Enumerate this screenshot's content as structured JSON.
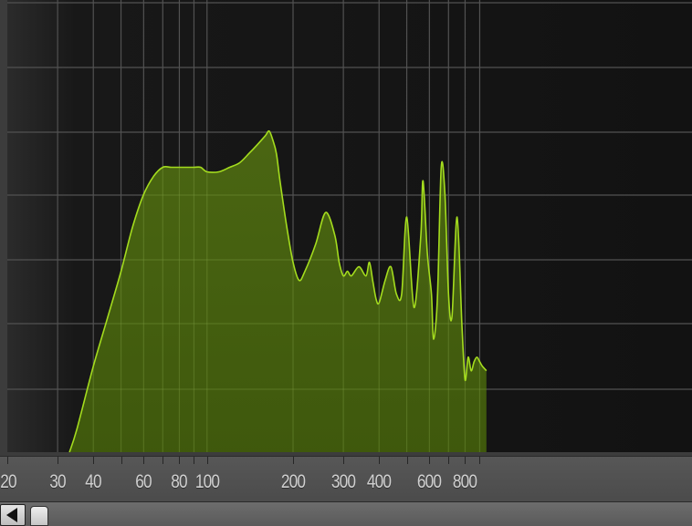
{
  "analyzer": {
    "freq_axis": {
      "scale": "log",
      "labels": [
        "20",
        "30",
        "40",
        "60",
        "80",
        "100",
        "200",
        "300",
        "400",
        "600",
        "800"
      ],
      "label_values": [
        20,
        30,
        40,
        60,
        80,
        100,
        200,
        300,
        400,
        600,
        800
      ],
      "grid_freqs": [
        30,
        40,
        50,
        60,
        70,
        80,
        90,
        100,
        200,
        300,
        400,
        500,
        600,
        700,
        800,
        900
      ]
    },
    "fill_color": "#4d6a12",
    "line_color": "#a4dc1e",
    "grid_color": "#525252"
  },
  "chart_data": {
    "type": "area",
    "xscale": "log",
    "xlim": [
      20,
      950
    ],
    "ylim": [
      0,
      1
    ],
    "grid": true,
    "x": [
      33,
      35,
      40,
      45,
      50,
      55,
      60,
      65,
      70,
      75,
      80,
      85,
      90,
      95,
      100,
      110,
      120,
      130,
      140,
      150,
      160,
      165,
      170,
      175,
      180,
      190,
      200,
      210,
      220,
      240,
      260,
      280,
      290,
      300,
      310,
      320,
      340,
      360,
      370,
      380,
      390,
      400,
      420,
      440,
      460,
      480,
      500,
      530,
      560,
      570,
      590,
      610,
      620,
      640,
      660,
      680,
      700,
      720,
      750,
      780,
      800,
      820,
      840,
      860,
      880,
      900,
      920,
      950
    ],
    "values": [
      0.0,
      0.05,
      0.19,
      0.3,
      0.4,
      0.5,
      0.57,
      0.61,
      0.63,
      0.63,
      0.63,
      0.63,
      0.63,
      0.63,
      0.62,
      0.62,
      0.63,
      0.64,
      0.66,
      0.68,
      0.7,
      0.71,
      0.69,
      0.66,
      0.6,
      0.5,
      0.42,
      0.38,
      0.4,
      0.46,
      0.53,
      0.48,
      0.42,
      0.39,
      0.4,
      0.39,
      0.41,
      0.39,
      0.42,
      0.38,
      0.34,
      0.33,
      0.38,
      0.41,
      0.35,
      0.35,
      0.52,
      0.32,
      0.48,
      0.6,
      0.44,
      0.35,
      0.25,
      0.34,
      0.63,
      0.57,
      0.35,
      0.3,
      0.52,
      0.28,
      0.16,
      0.21,
      0.18,
      0.2,
      0.21,
      0.2,
      0.19,
      0.18
    ]
  }
}
